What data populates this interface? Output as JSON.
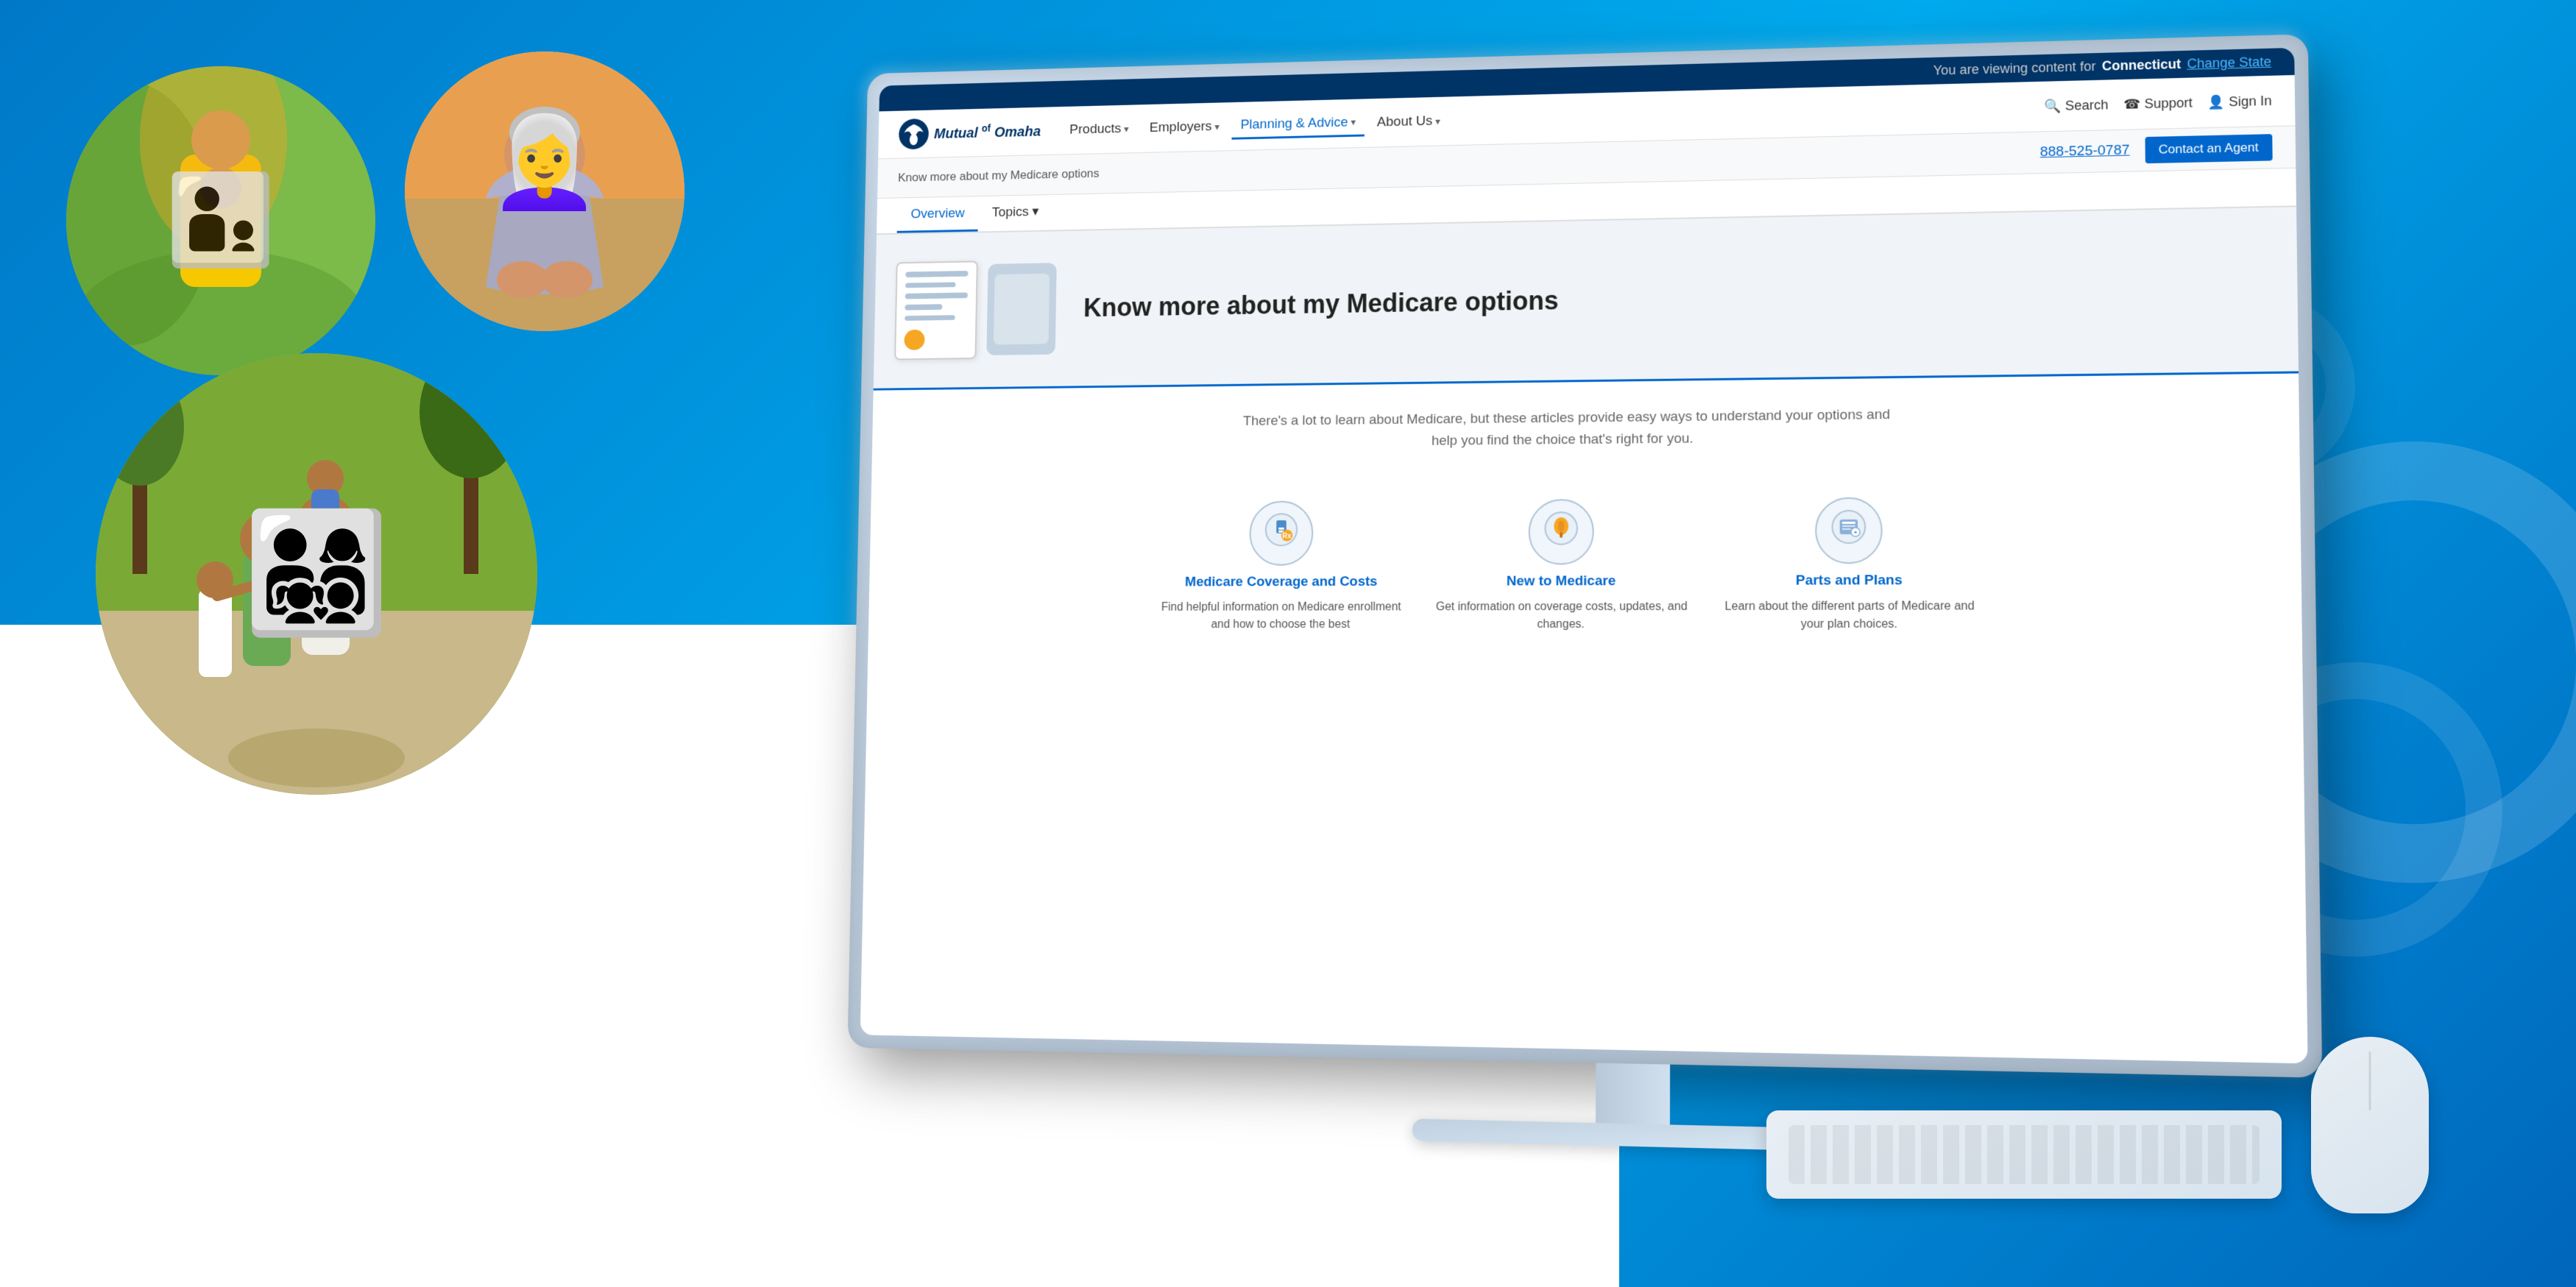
{
  "background": {
    "color": "#0078c8"
  },
  "topBar": {
    "viewing_text": "You are viewing content for",
    "state": "Connecticut",
    "change_link": "Change State"
  },
  "nav": {
    "logo": {
      "brand": "Mutual",
      "of": "of",
      "company": "Omaha"
    },
    "items": [
      {
        "label": "Products",
        "has_dropdown": true
      },
      {
        "label": "Employers",
        "has_dropdown": true
      },
      {
        "label": "Planning & Advice",
        "has_dropdown": true,
        "active": true
      },
      {
        "label": "About Us",
        "has_dropdown": true
      }
    ],
    "right_items": [
      {
        "label": "Search",
        "icon": "search"
      },
      {
        "label": "Support",
        "icon": "support"
      },
      {
        "label": "Sign In",
        "icon": "person"
      }
    ]
  },
  "secondary_nav": {
    "breadcrumb": "Know more about my Medicare options",
    "phone": "888-525-0787",
    "contact_btn": "Contact an Agent"
  },
  "tabs": [
    {
      "label": "Overview",
      "active": true
    },
    {
      "label": "Topics",
      "has_dropdown": true
    }
  ],
  "hero": {
    "title": "Know more about my Medicare options"
  },
  "description": {
    "text": "There's a lot to learn about Medicare, but these articles provide easy ways to understand your options and help you find the choice that's right for you."
  },
  "cards": [
    {
      "title": "Medicare Coverage and Costs",
      "description": "Find helpful information on Medicare enrollment and how to choose the best",
      "icon": "💊"
    },
    {
      "title": "New to Medicare",
      "description": "Get information on coverage costs, updates, and changes.",
      "icon": "💉"
    },
    {
      "title": "Parts and Plans",
      "description": "Learn about the different parts of Medicare and your plan choices.",
      "icon": "🏥"
    }
  ],
  "photos": [
    {
      "id": "circle-1",
      "description": "Parent and child in yellow raincoat"
    },
    {
      "id": "circle-2",
      "description": "Elderly woman smiling on beach"
    },
    {
      "id": "circle-3",
      "description": "Happy family walking"
    }
  ]
}
